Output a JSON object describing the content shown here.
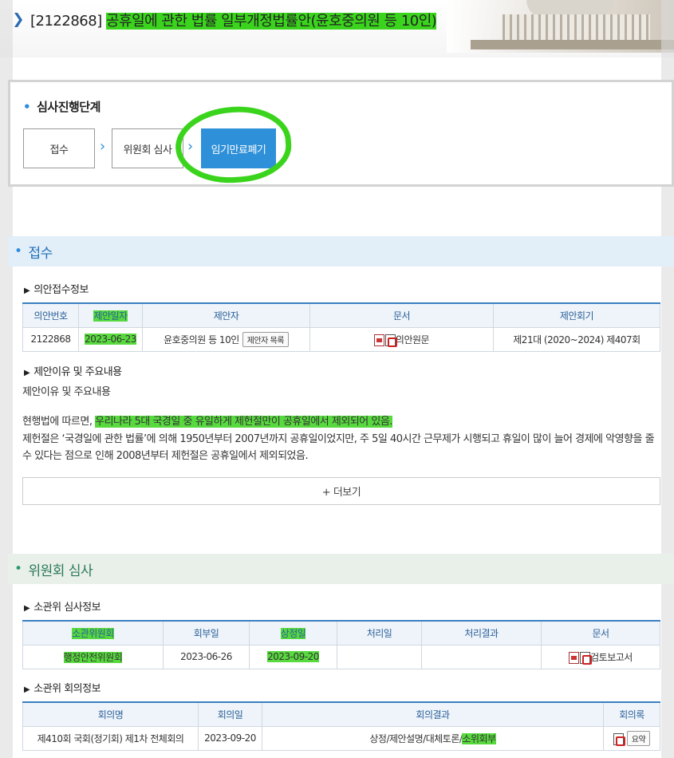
{
  "header": {
    "bill_id": "[2122868]",
    "bill_title": "공휴일에 관한 법률 일부개정법률안(윤호중의원 등 10인)"
  },
  "progress": {
    "heading": "심사진행단계",
    "steps": [
      "접수",
      "위원회 심사",
      "임기만료폐기"
    ]
  },
  "reception": {
    "section_title": "접수",
    "info_title": "의안접수정보",
    "columns": [
      "의안번호",
      "제안일자",
      "제안자",
      "문서",
      "제안회기"
    ],
    "row": {
      "bill_no": "2122868",
      "date": "2023-06-23",
      "proposer": "윤호중의원 등 10인",
      "proposer_btn": "제안자 목록",
      "doc": "의안원문",
      "session": "제21대 (2020~2024) 제407회"
    },
    "reason_title": "제안이유 및 주요내용",
    "reason_label": "제안이유 및 주요내용",
    "para1_prefix": "현행법에 따르면, ",
    "para1_highlight": "우리나라 5대 국경일 중 유일하게 제헌절만이 공휴일에서 제외되어 있음.",
    "para2": "제헌절은 ‘국경일에 관한 법률’에 의해 1950년부터 2007년까지 공휴일이었지만, 주 5일 40시간 근무제가 시행되고 휴일이 많이 늘어 경제에 악영향을 줄 수 있다는 점으로 인해 2008년부터 제헌절은 공휴일에서 제외되었음.",
    "more_label": "+ 더보기"
  },
  "committee": {
    "section_title": "위원회 심사",
    "info_title": "소관위 심사정보",
    "columns": [
      "소관위원회",
      "회부일",
      "상정일",
      "처리일",
      "처리결과",
      "문서"
    ],
    "row": {
      "committee": "행정안전위원회",
      "referred": "2023-06-26",
      "presented": "2023-09-20",
      "processed": "",
      "result": "",
      "doc": "검토보고서"
    },
    "meeting_title": "소관위 회의정보",
    "meeting_columns": [
      "회의명",
      "회의일",
      "회의결과",
      "회의록"
    ],
    "meeting_row": {
      "name": "제410회 국회(정기회) 제1차 전체회의",
      "date": "2023-09-20",
      "result_prefix": "상정/제안설명/대체토론/",
      "result_highlight": "소위회부",
      "minutes_btn": "요약"
    }
  },
  "colors": {
    "accent": "#2e90d8",
    "highlight": "#3bd41d"
  }
}
